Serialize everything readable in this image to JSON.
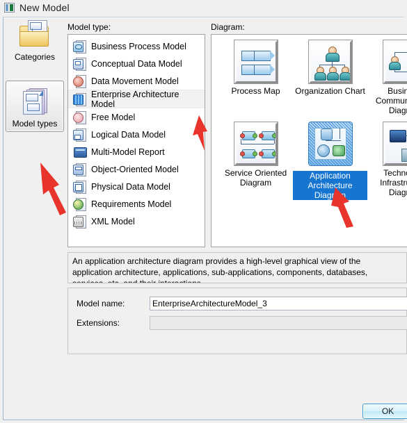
{
  "window": {
    "title": "New Model",
    "icon": "new-model-icon"
  },
  "rail": {
    "items": [
      {
        "label": "Categories",
        "icon": "categories-icon",
        "selected": false
      },
      {
        "label": "Model types",
        "icon": "model-types-icon",
        "selected": true
      }
    ]
  },
  "model_type": {
    "label": "Model type:",
    "items": [
      {
        "label": "Business Process Model",
        "icon": "business-process-model-icon",
        "selected": false
      },
      {
        "label": "Conceptual Data Model",
        "icon": "conceptual-data-model-icon",
        "selected": false
      },
      {
        "label": "Data Movement Model",
        "icon": "data-movement-model-icon",
        "selected": false
      },
      {
        "label": "Enterprise Architecture Model",
        "icon": "enterprise-architecture-model-icon",
        "selected": true
      },
      {
        "label": "Free Model",
        "icon": "free-model-icon",
        "selected": false
      },
      {
        "label": "Logical Data Model",
        "icon": "logical-data-model-icon",
        "selected": false
      },
      {
        "label": "Multi-Model Report",
        "icon": "multi-model-report-icon",
        "selected": false
      },
      {
        "label": "Object-Oriented Model",
        "icon": "object-oriented-model-icon",
        "selected": false
      },
      {
        "label": "Physical Data Model",
        "icon": "physical-data-model-icon",
        "selected": false
      },
      {
        "label": "Requirements Model",
        "icon": "requirements-model-icon",
        "selected": false
      },
      {
        "label": "XML Model",
        "icon": "xml-model-icon",
        "selected": false
      }
    ]
  },
  "diagram": {
    "label": "Diagram:",
    "items": [
      {
        "label": "Process Map",
        "icon": "process-map-icon",
        "selected": false
      },
      {
        "label": "Organization Chart",
        "icon": "organization-chart-icon",
        "selected": false
      },
      {
        "label": "Business\nCommunication Diagram",
        "icon": "business-communication-diagram-icon",
        "selected": false
      },
      {
        "label": "Service Oriented\nDiagram",
        "icon": "service-oriented-diagram-icon",
        "selected": false
      },
      {
        "label": "Application\nArchitecture Diagram",
        "icon": "application-architecture-diagram-icon",
        "selected": true
      },
      {
        "label": "Technology\nInfrastructure Diagram",
        "icon": "technology-infrastructure-diagram-icon",
        "selected": false
      }
    ]
  },
  "description": "An application architecture diagram provides a high-level graphical view of the application architecture, applications, sub-applications, components, databases, services, etc, and their interactions.",
  "form": {
    "model_name_label": "Model name:",
    "model_name_value": "EnterpriseArchitectureModel_3",
    "model_name_placeholder": "",
    "extensions_label": "Extensions:",
    "extensions_value": "",
    "extensions_placeholder": ""
  },
  "buttons": {
    "ok": "OK"
  },
  "colors": {
    "selection_blue": "#1675d1",
    "annotation_red": "#e8342a",
    "dialog_bg": "#f0f0f0",
    "ok_border": "#3c9ccd"
  },
  "annotations": [
    {
      "name": "arrow-to-model-types",
      "target": "model-types-rail-button"
    },
    {
      "name": "arrow-to-enterprise-architecture-model",
      "target": "enterprise-architecture-model-row"
    },
    {
      "name": "arrow-to-application-architecture-diagram",
      "target": "application-architecture-diagram-item"
    }
  ]
}
